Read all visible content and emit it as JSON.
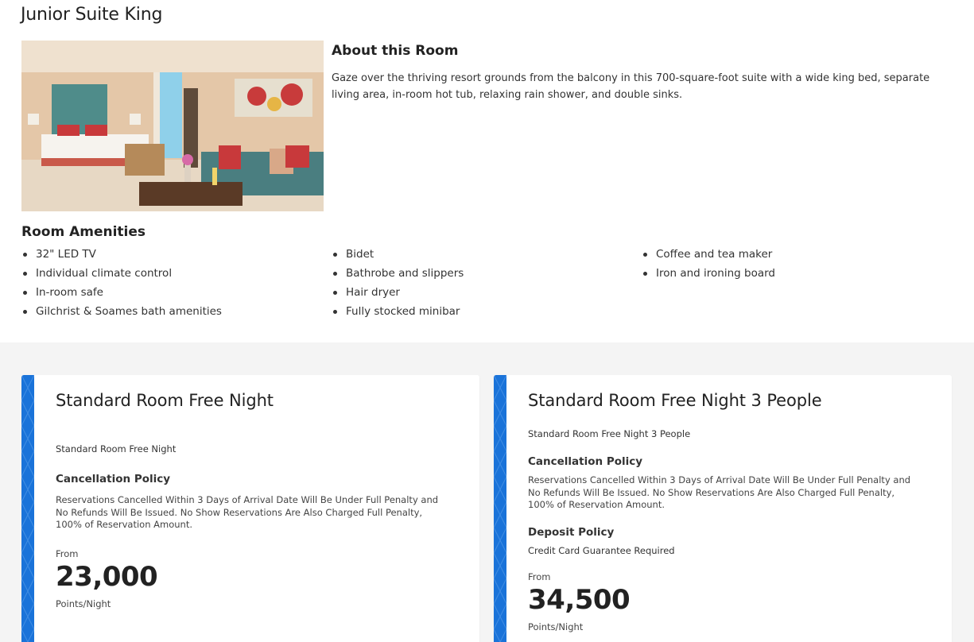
{
  "room": {
    "title": "Junior Suite King",
    "photo_alt": "Junior suite bedroom and living area"
  },
  "about": {
    "heading": "About this Room",
    "description": "Gaze over the thriving resort grounds from the balcony in this 700-square-foot suite with a wide king bed, separate living area, in-room hot tub, relaxing rain shower, and double sinks."
  },
  "amenities": {
    "heading": "Room Amenities",
    "columns": [
      [
        "32\" LED TV",
        "Individual climate control",
        "In-room safe",
        "Gilchrist & Soames bath amenities"
      ],
      [
        "Bidet",
        "Bathrobe and slippers",
        "Hair dryer",
        "Fully stocked minibar"
      ],
      [
        "Coffee and tea maker",
        "Iron and ironing board"
      ]
    ]
  },
  "rates": [
    {
      "title": "Standard Room Free Night",
      "subtitle": "Standard Room Free Night",
      "cancellation_heading": "Cancellation Policy",
      "cancellation_text": "Reservations Cancelled Within 3 Days of Arrival Date Will Be Under Full Penalty and No Refunds Will Be Issued. No Show Reservations Are Also Charged Full Penalty, 100% of Reservation Amount.",
      "from_label": "From",
      "price": "23,000",
      "unit": "Points/Night"
    },
    {
      "title": "Standard Room Free Night 3 People",
      "subtitle": "Standard Room Free Night 3 People",
      "cancellation_heading": "Cancellation Policy",
      "cancellation_text": "Reservations Cancelled Within 3 Days of Arrival Date Will Be Under Full Penalty and No Refunds Will Be Issued. No Show Reservations Are Also Charged Full Penalty, 100% of Reservation Amount.",
      "deposit_heading": "Deposit Policy",
      "deposit_text": "Credit Card Guarantee Required",
      "from_label": "From",
      "price": "34,500",
      "unit": "Points/Night"
    }
  ],
  "colors": {
    "accent": "#1a73d9",
    "band_bg": "#f4f4f4"
  }
}
